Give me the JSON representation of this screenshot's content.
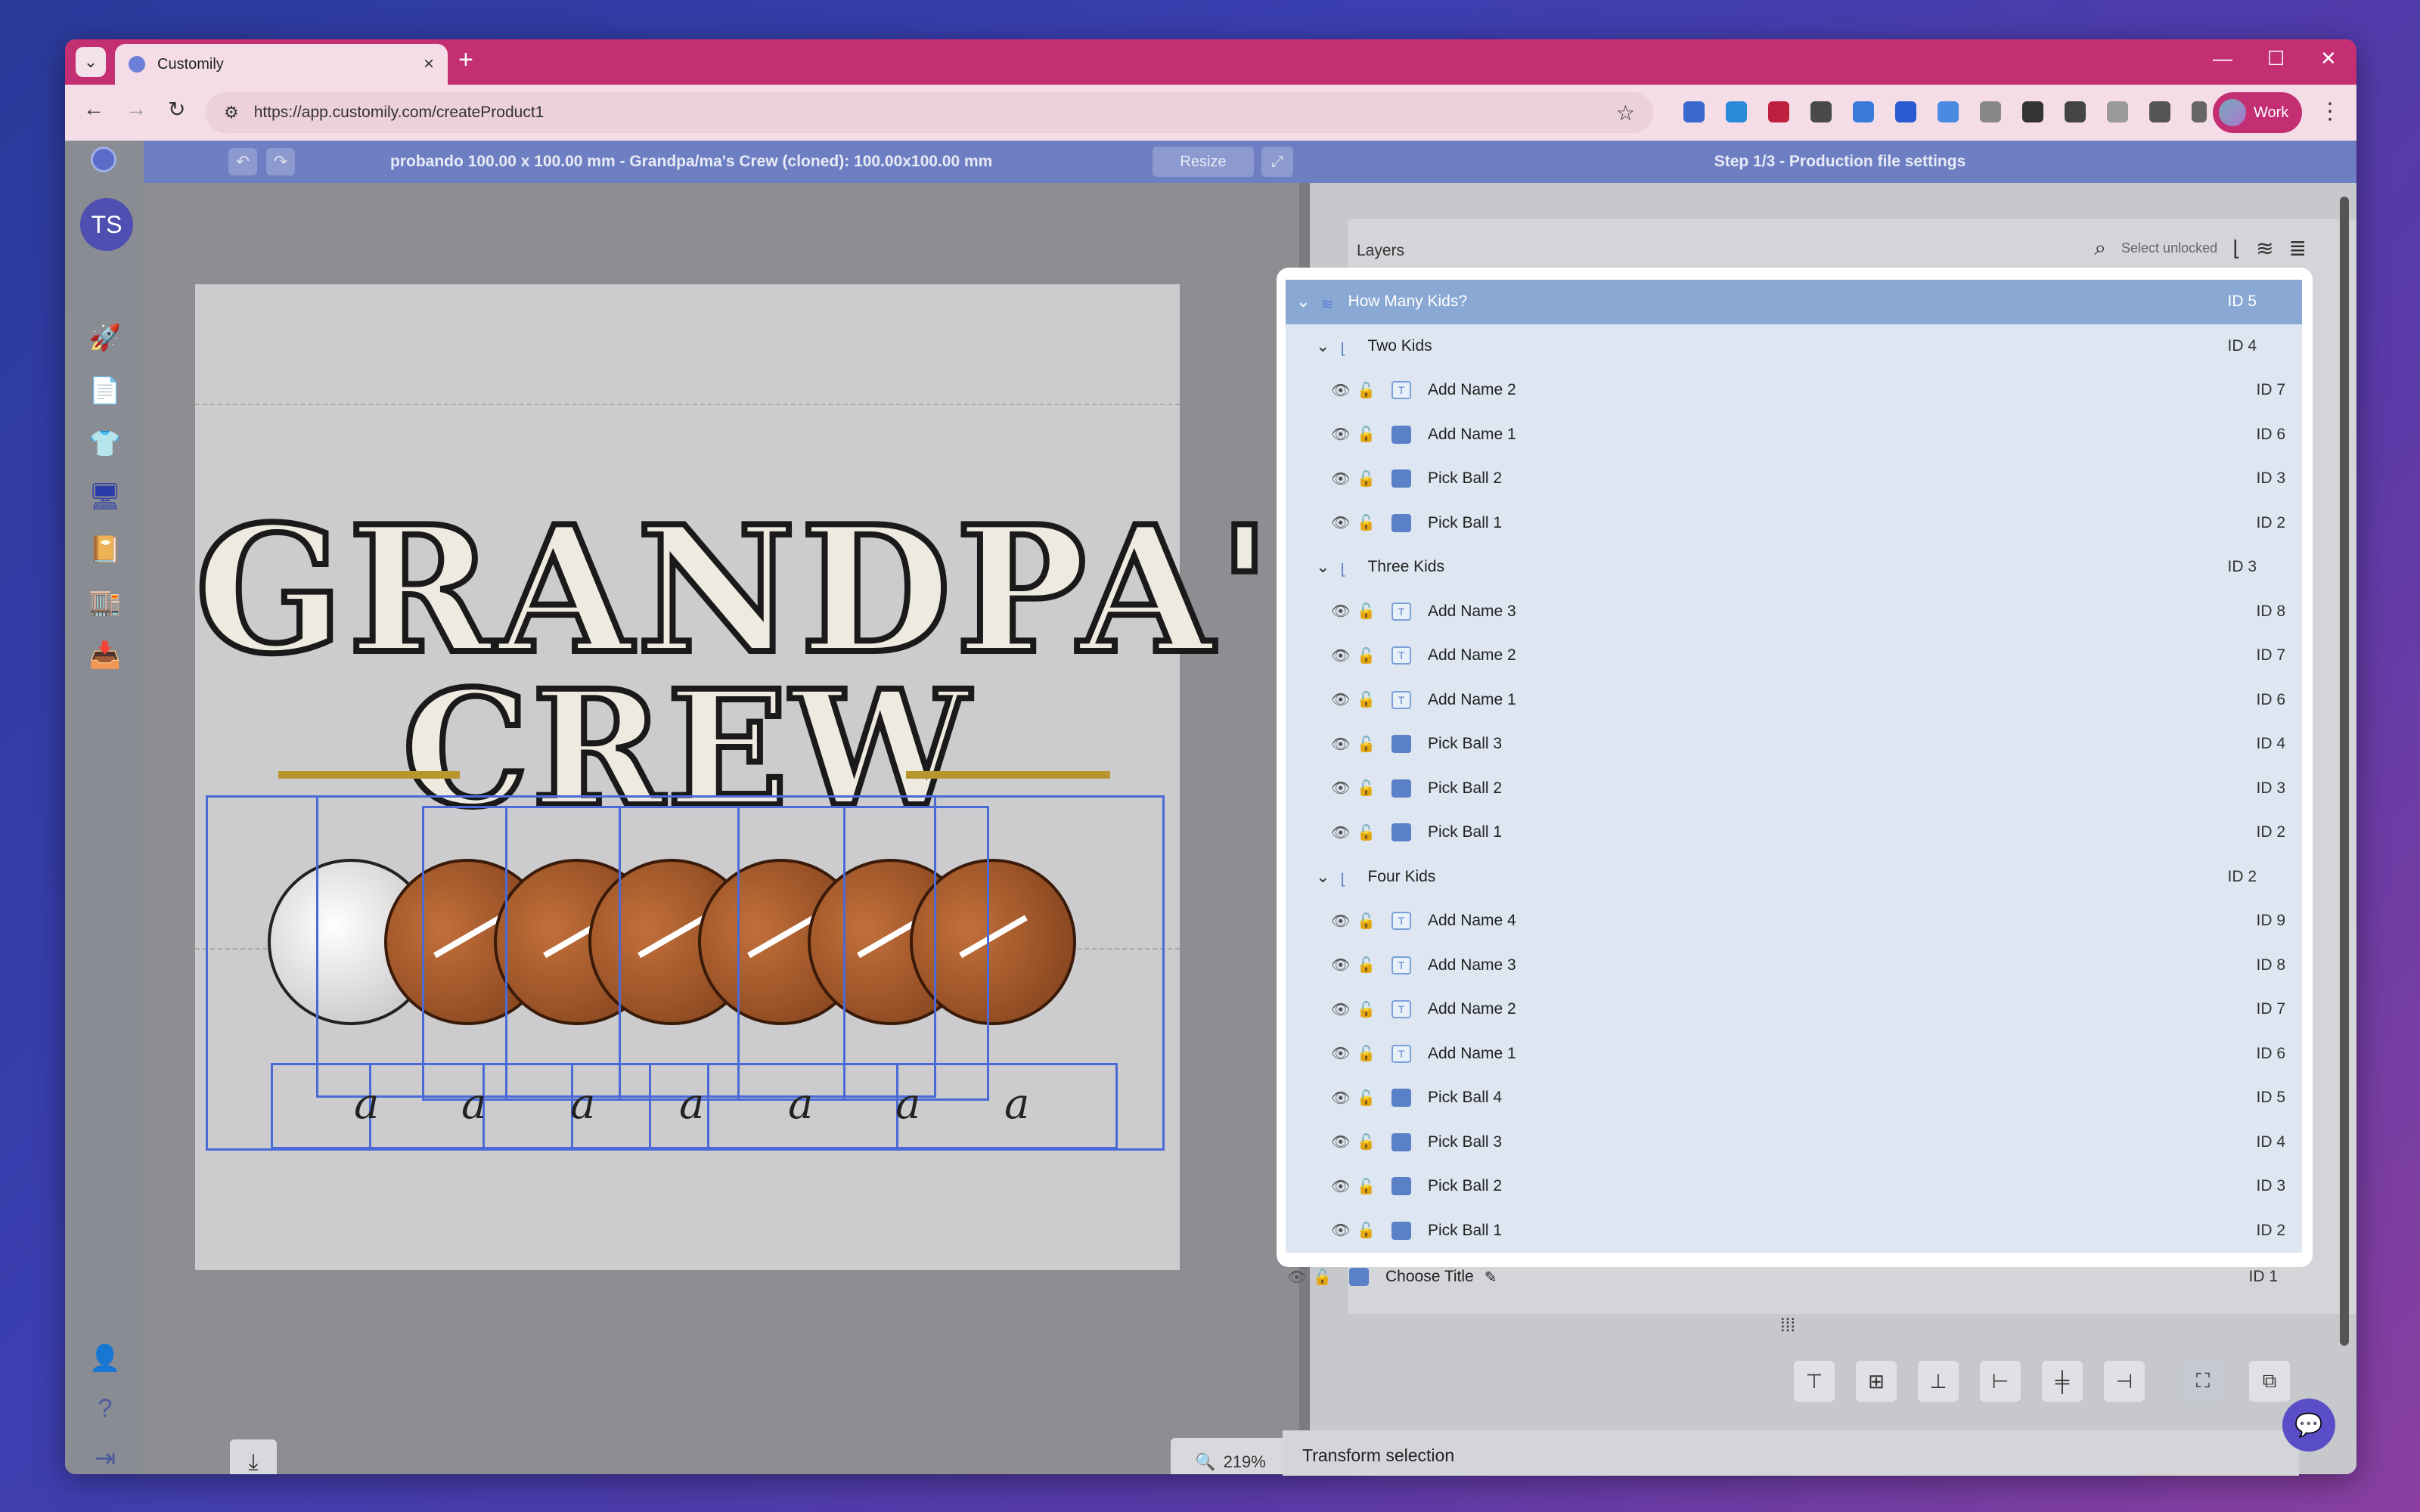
{
  "browser": {
    "tab_title": "Customily",
    "url": "https://app.customily.com/createProduct1",
    "profile_label": "Work"
  },
  "editor": {
    "avatar_initials": "TS",
    "doc_title": "probando 100.00 x 100.00 mm - Grandpa/ma's Crew (cloned): 100.00x100.00 mm",
    "resize_label": "Resize",
    "step_title": "Step 1/3 - Production file settings",
    "zoom": "219%",
    "artwork": {
      "title_line1": "GRANDPA'S",
      "title_line2": "CREW",
      "placeholder_letter": "a"
    }
  },
  "layers": {
    "title": "Layers",
    "search_placeholder": "Select unlocked",
    "root": {
      "label": "How Many Kids?",
      "id": "ID 5"
    },
    "groups": [
      {
        "label": "Two Kids",
        "id": "ID 4",
        "items": [
          {
            "type": "text",
            "label": "Add Name 2",
            "id": "ID 7"
          },
          {
            "type": "image",
            "label": "Add Name 1",
            "id": "ID 6"
          },
          {
            "type": "image",
            "label": "Pick Ball 2",
            "id": "ID 3"
          },
          {
            "type": "image",
            "label": "Pick Ball 1",
            "id": "ID 2"
          }
        ]
      },
      {
        "label": "Three Kids",
        "id": "ID 3",
        "items": [
          {
            "type": "text",
            "label": "Add Name 3",
            "id": "ID 8"
          },
          {
            "type": "text",
            "label": "Add Name 2",
            "id": "ID 7"
          },
          {
            "type": "text",
            "label": "Add Name 1",
            "id": "ID 6"
          },
          {
            "type": "image",
            "label": "Pick Ball 3",
            "id": "ID 4"
          },
          {
            "type": "image",
            "label": "Pick Ball 2",
            "id": "ID 3"
          },
          {
            "type": "image",
            "label": "Pick Ball 1",
            "id": "ID 2"
          }
        ]
      },
      {
        "label": "Four Kids",
        "id": "ID 2",
        "items": [
          {
            "type": "text",
            "label": "Add Name 4",
            "id": "ID 9"
          },
          {
            "type": "text",
            "label": "Add Name 3",
            "id": "ID 8"
          },
          {
            "type": "text",
            "label": "Add Name 2",
            "id": "ID 7"
          },
          {
            "type": "text",
            "label": "Add Name 1",
            "id": "ID 6"
          },
          {
            "type": "image",
            "label": "Pick Ball 4",
            "id": "ID 5"
          },
          {
            "type": "image",
            "label": "Pick Ball 3",
            "id": "ID 4"
          },
          {
            "type": "image",
            "label": "Pick Ball 2",
            "id": "ID 3"
          },
          {
            "type": "image",
            "label": "Pick Ball 1",
            "id": "ID 2"
          }
        ]
      }
    ],
    "bottom_item": {
      "label": "Choose Title",
      "id": "ID 1"
    }
  },
  "transform_label": "Transform selection",
  "colors": {
    "accent": "#6d7fc2",
    "tabstrip": "#c42e73",
    "selection": "#4a6ad8",
    "row_highlight": "#8aa8d4"
  }
}
